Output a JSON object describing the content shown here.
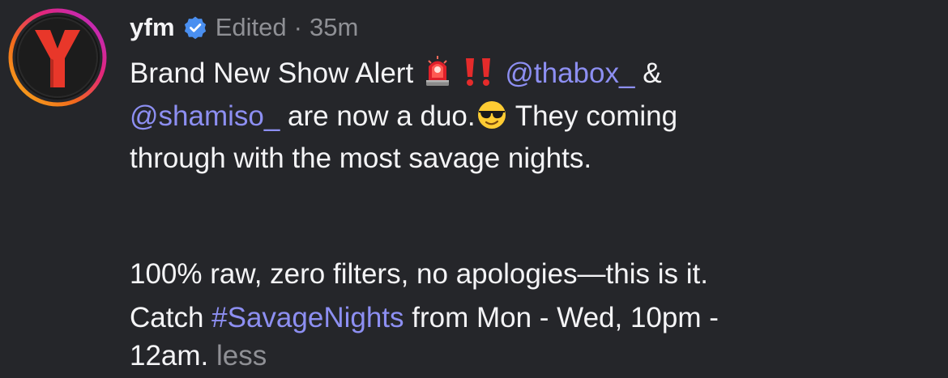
{
  "post": {
    "username": "yfm",
    "edited_label": "Edited",
    "separator": "·",
    "time_ago": "35m",
    "line1_text": "Brand New Show Alert ",
    "line1_space": " ",
    "mention1": "@thabox_",
    "line1_amp": " &",
    "mention2": "@shamiso_",
    "line2_text": " are now a duo.",
    "line2_rest": " They coming",
    "line3_text": "through with the most savage nights.",
    "para2_line1": "100% raw, zero filters, no apologies—this is it.",
    "para2_line2_prefix": "Catch ",
    "hashtag": "#SavageNights",
    "para2_line2_suffix": " from Mon - Wed, 10pm -",
    "para2_line3": "12am.",
    "less_label": " less"
  },
  "avatar": {
    "letter": "Y"
  },
  "colors": {
    "background": "#25262a",
    "text": "#f4f4f6",
    "muted": "#8f9095",
    "link": "#8d8ff2",
    "verified": "#4a8ff0",
    "avatar_red": "#e8372a"
  },
  "icons": {
    "verified": "verified-badge-icon",
    "siren": "police-siren-emoji",
    "exclamation": "double-exclamation-emoji",
    "sunglasses": "sunglasses-face-emoji"
  }
}
